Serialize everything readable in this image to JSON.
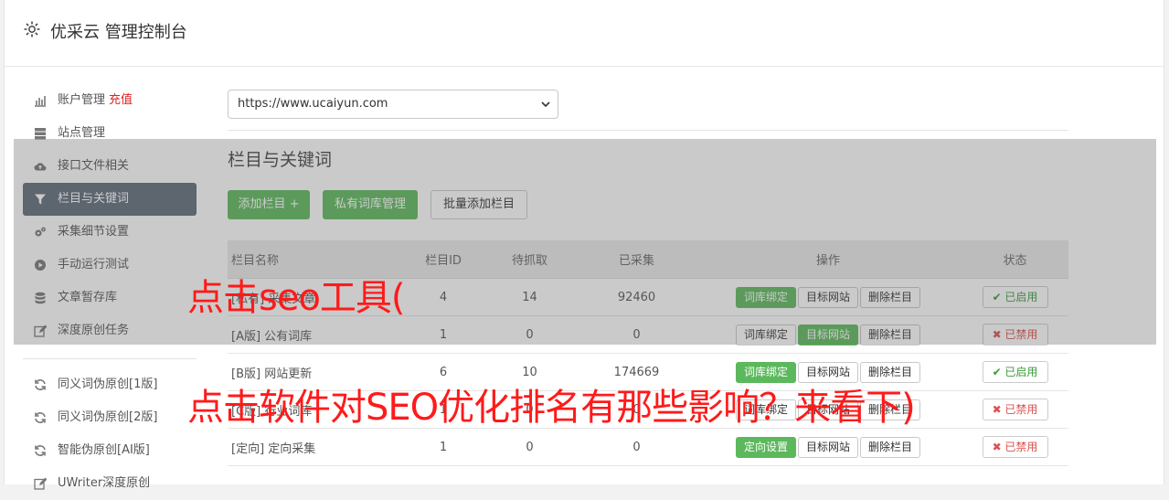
{
  "header": {
    "title": "优采云 管理控制台",
    "icon": "gear-icon"
  },
  "sidebar": {
    "items": [
      {
        "label": "账户管理",
        "extra": "充值",
        "icon": "bar-chart-icon"
      },
      {
        "label": "站点管理",
        "icon": "server-icon"
      },
      {
        "label": "接口文件相关",
        "icon": "cloud-upload-icon"
      },
      {
        "label": "栏目与关键词",
        "icon": "filter-icon",
        "active": true
      },
      {
        "label": "采集细节设置",
        "icon": "cogs-icon"
      },
      {
        "label": "手动运行测试",
        "icon": "play-circle-icon"
      },
      {
        "label": "文章暂存库",
        "icon": "database-icon"
      },
      {
        "label": "深度原创任务",
        "icon": "edit-icon"
      }
    ],
    "items2": [
      {
        "label": "同义词伪原创[1版]",
        "icon": "refresh-icon"
      },
      {
        "label": "同义词伪原创[2版]",
        "icon": "refresh-icon"
      },
      {
        "label": "智能伪原创[AI版]",
        "icon": "refresh-icon"
      },
      {
        "label": "UWriter深度原创",
        "icon": "edit-icon"
      }
    ]
  },
  "site_select": {
    "value": "https://www.ucaiyun.com"
  },
  "section": {
    "title": "栏目与关键词",
    "buttons": {
      "add": "添加栏目 +",
      "private_lib": "私有词库管理",
      "batch_add": "批量添加栏目"
    }
  },
  "table": {
    "headers": {
      "name": "栏目名称",
      "id": "栏目ID",
      "pending": "待抓取",
      "collected": "已采集",
      "ops": "操作",
      "status": "状态"
    },
    "rows": [
      {
        "name": "[私有] 采集文章",
        "id": "4",
        "pending": "14",
        "collected": "92460",
        "op1": "词库绑定",
        "op2": "目标网站",
        "op3": "删除栏目",
        "status": "✔ 已启用"
      },
      {
        "name": "[A版] 公有词库",
        "id": "1",
        "pending": "0",
        "collected": "0",
        "op1": "词库绑定",
        "op2": "目标网站",
        "op3": "删除栏目",
        "status": "✖ 已禁用"
      },
      {
        "name": "[B版] 网站更新",
        "id": "6",
        "pending": "10",
        "collected": "174669",
        "op1": "词库绑定",
        "op2": "目标网站",
        "op3": "删除栏目",
        "status": "✔ 已启用"
      },
      {
        "name": "[C版] 行业词库",
        "id": "1",
        "pending": "0",
        "collected": "0",
        "op1": "词库绑定",
        "op2": "目标网站",
        "op3": "删除栏目",
        "status": "✖ 已禁用"
      },
      {
        "name": "[定向] 定向采集",
        "id": "1",
        "pending": "0",
        "collected": "0",
        "op1": "定向设置",
        "op2": "目标网站",
        "op3": "删除栏目",
        "status": "✖ 已禁用"
      }
    ]
  },
  "annotations": {
    "line1": "点击seo工具(",
    "line2": "点击软件对SEO优化排名有那些影响？来看下)"
  },
  "colors": {
    "accent_green": "#5cb85c",
    "sidebar_active": "#5f6b7a",
    "annotation_red": "#ff1a1a"
  }
}
